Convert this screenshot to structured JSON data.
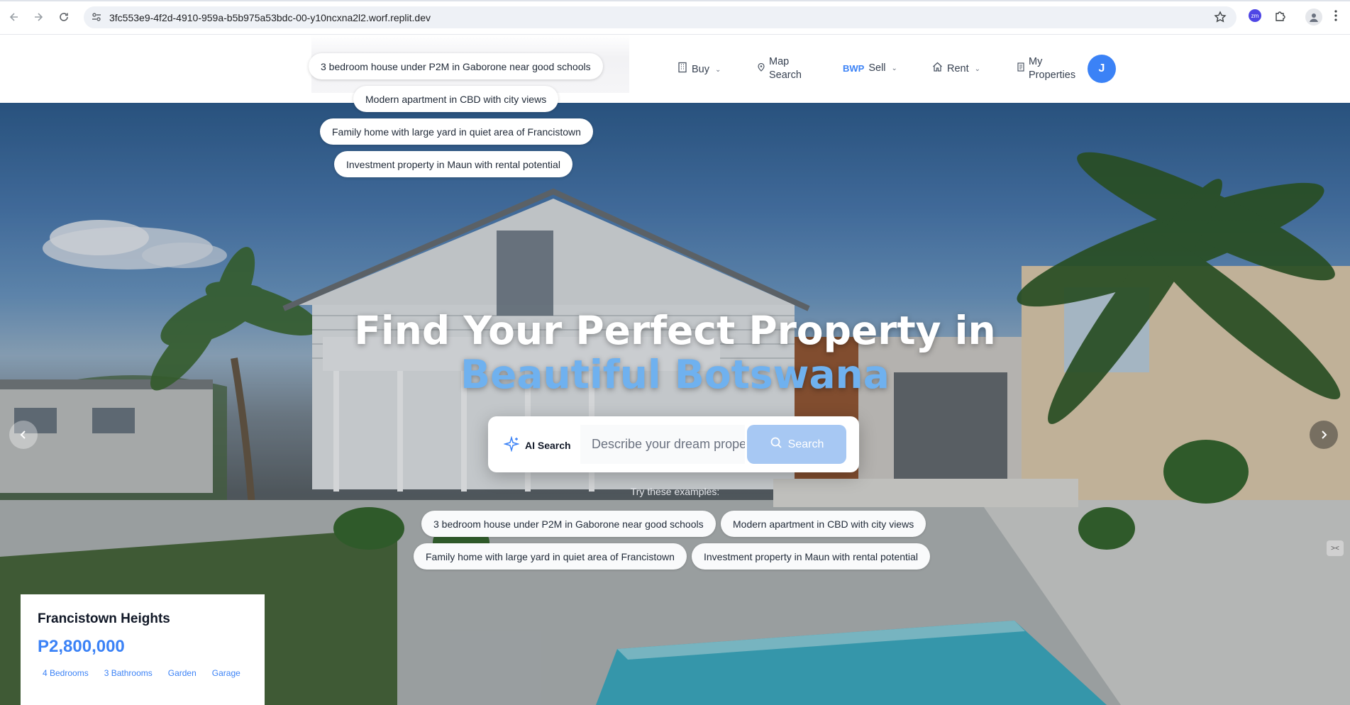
{
  "browser": {
    "url": "3fc553e9-4f2d-4910-959a-b5b975a53bdc-00-y10ncxna2l2.worf.replit.dev",
    "extension_badge": "zm"
  },
  "header": {
    "nav": {
      "buy": "Buy",
      "map_search": "Map Search",
      "sell_currency": "BWP",
      "sell": "Sell",
      "rent": "Rent",
      "my_properties": "My Properties"
    },
    "avatar_initial": "J"
  },
  "suggestions_dropdown": [
    "3 bedroom house under P2M in Gaborone near good schools",
    "Modern apartment in CBD with city views",
    "Family home with large yard in quiet area of Francistown",
    "Investment property in Maun with rental potential"
  ],
  "hero": {
    "title_line1": "Find Your Perfect Property in",
    "title_line2": "Beautiful Botswana",
    "search": {
      "ai_label": "AI Search",
      "placeholder": "Describe your dream property",
      "button": "Search"
    },
    "try_label": "Try these examples:",
    "examples": [
      "3 bedroom house under P2M in Gaborone near good schools",
      "Modern apartment in CBD with city views",
      "Family home with large yard in quiet area of Francistown",
      "Investment property in Maun with rental potential"
    ]
  },
  "featured_property": {
    "name": "Francistown Heights",
    "price": "P2,800,000",
    "features": [
      "4 Bedrooms",
      "3 Bathrooms",
      "Garden",
      "Garage"
    ]
  },
  "colors": {
    "accent": "#3b82f6",
    "title_highlight": "#6fb1ef",
    "search_button": "#a7c8f3"
  }
}
